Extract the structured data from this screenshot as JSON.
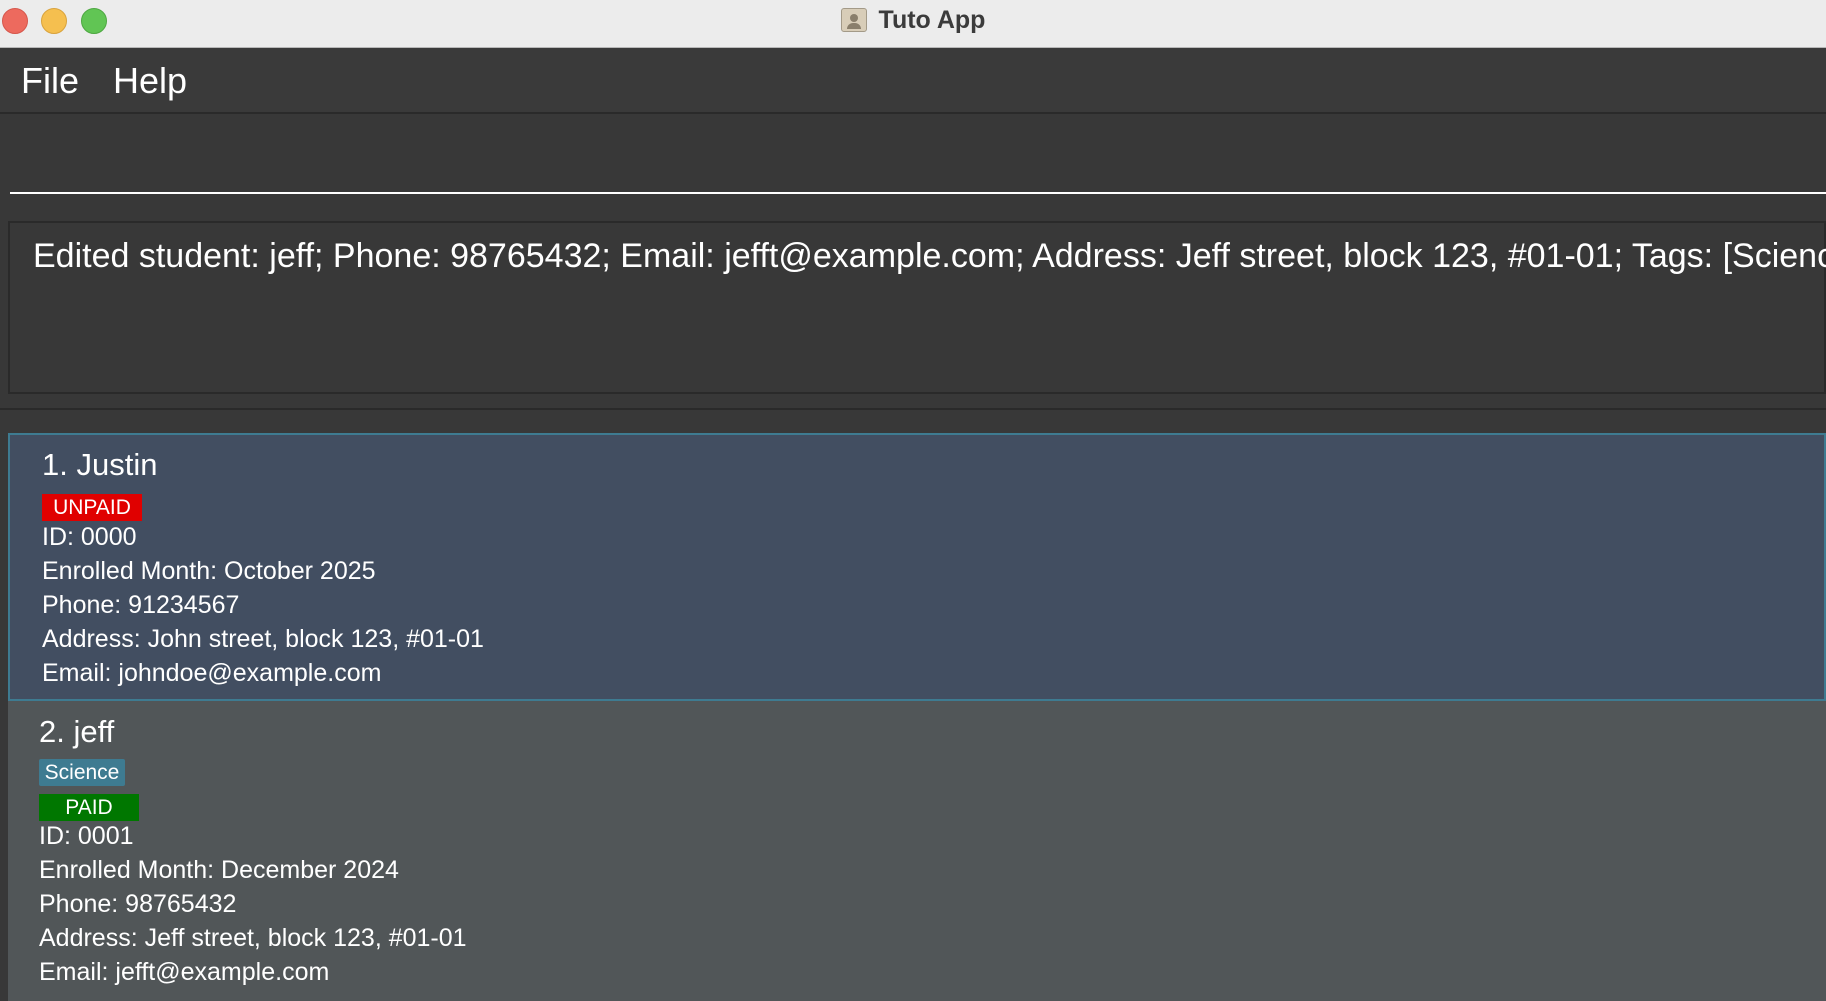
{
  "window": {
    "title": "Tuto App"
  },
  "menu": {
    "file_label": "File",
    "help_label": "Help"
  },
  "command": {
    "value": ""
  },
  "result": {
    "message": "Edited student: jeff; Phone: 98765432; Email: jefft@example.com; Address: Jeff street, block 123, #01-01; Tags: [Science]"
  },
  "students": [
    {
      "name": "1. Justin",
      "tags": [],
      "payment_status": "UNPAID",
      "payment_color": "#e00000",
      "id": "ID: 0000",
      "enrolled": "Enrolled Month: October 2025",
      "phone": "Phone: 91234567",
      "address": "Address: John street, block 123, #01-01",
      "email": "Email: johndoe@example.com",
      "selected": true
    },
    {
      "name": "2. jeff",
      "tags": [
        "Science"
      ],
      "payment_status": "PAID",
      "payment_color": "#007700",
      "id": "ID: 0001",
      "enrolled": "Enrolled Month: December 2024",
      "phone": "Phone: 98765432",
      "address": "Address: Jeff street, block 123, #01-01",
      "email": "Email: jefft@example.com",
      "selected": false
    }
  ],
  "colors": {
    "background": "#383838",
    "selected_card": "#424e61",
    "card": "#515658",
    "tag": "#3e7b91",
    "unpaid": "#e00000",
    "paid": "#007700"
  }
}
